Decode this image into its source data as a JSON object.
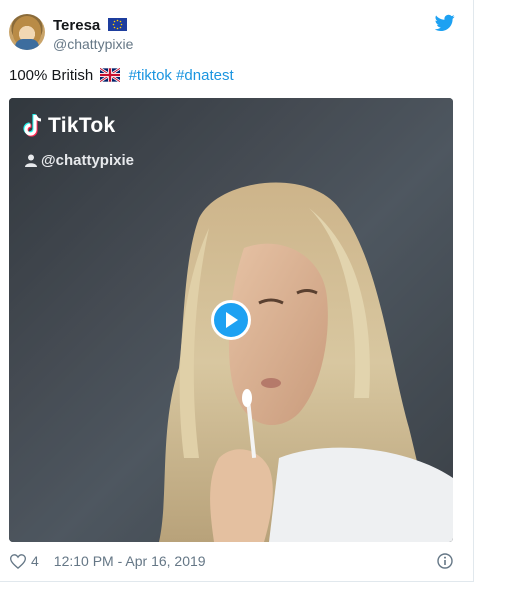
{
  "author": {
    "name": "Teresa",
    "handle": "@chattypixie"
  },
  "tweet": {
    "text_prefix": "100% British",
    "hashtags": [
      "#tiktok",
      "#dnatest"
    ]
  },
  "video": {
    "watermark_brand": "TikTok",
    "watermark_user": "@chattypixie"
  },
  "footer": {
    "likes": "4",
    "timestamp": "12:10 PM - Apr 16, 2019"
  },
  "icons": [
    "eu-flag-icon",
    "twitter-bird-icon",
    "uk-flag-icon",
    "tiktok-note-icon",
    "person-icon",
    "play-icon",
    "heart-icon",
    "info-icon"
  ],
  "colors": {
    "link": "#1b95e0",
    "play": "#1da1f2",
    "secondary_text": "#657786"
  }
}
